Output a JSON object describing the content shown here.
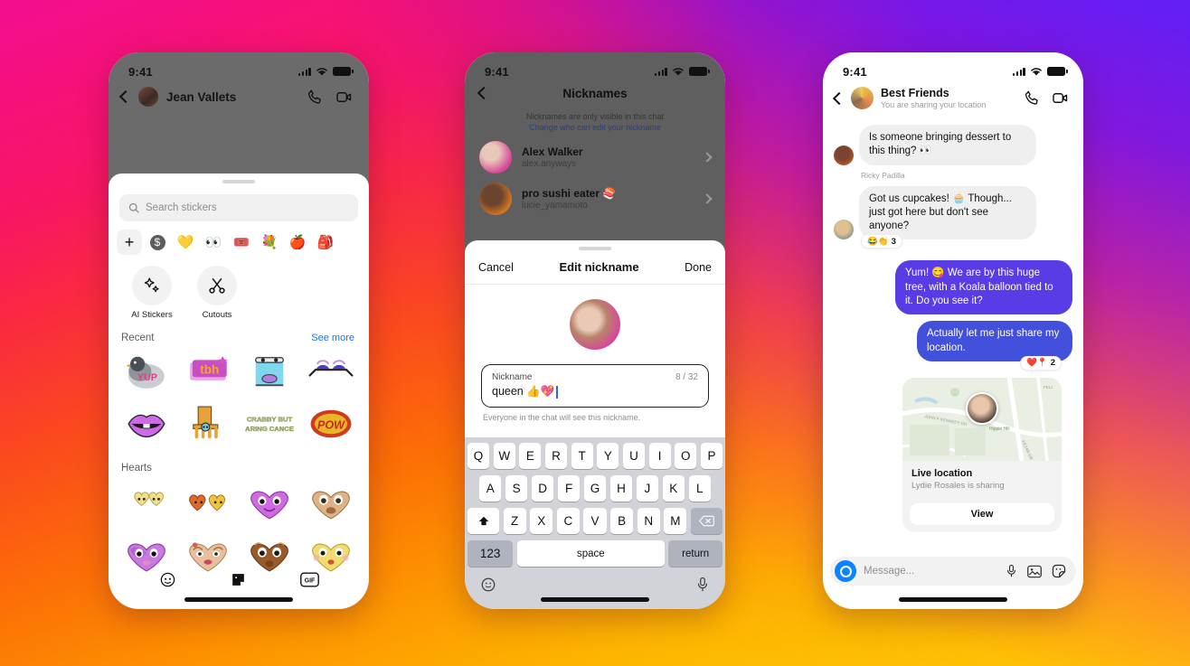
{
  "background": {
    "gradient_colors": [
      "#f20f8f",
      "#fb4a1d",
      "#ffcf00",
      "#5a1eff",
      "#a80ad0",
      "#ff1a5e"
    ]
  },
  "phone1": {
    "name": "sticker-tray-screen",
    "status": {
      "time": "9:41",
      "signal": "cellular-bars-icon",
      "wifi": "wifi-icon",
      "battery": "battery-full-icon"
    },
    "header": {
      "back": "chevron-left-icon",
      "title": "Jean Vallets",
      "call": "phone-call-icon",
      "video": "video-camera-icon"
    },
    "search": {
      "placeholder": "Search stickers",
      "icon": "search-icon"
    },
    "packs": [
      {
        "name": "add-pack",
        "glyph": "+"
      },
      {
        "name": "recent-pack",
        "glyph": "●"
      },
      {
        "name": "pack-yellow-heart",
        "glyph": "💛"
      },
      {
        "name": "pack-eyes",
        "glyph": "👀"
      },
      {
        "name": "pack-pink-card",
        "glyph": "🎟️"
      },
      {
        "name": "pack-flower",
        "glyph": "💐"
      },
      {
        "name": "pack-apple",
        "glyph": "🍎"
      },
      {
        "name": "pack-backpack",
        "glyph": "🎒"
      }
    ],
    "tools": [
      {
        "label": "AI Stickers",
        "icon": "sparkle-icon"
      },
      {
        "label": "Cutouts",
        "icon": "scissors-icon"
      }
    ],
    "sections": [
      {
        "title": "Recent",
        "action": "See more",
        "stickers": [
          {
            "name": "sticker-pigeon-yup",
            "glyph": "🐦"
          },
          {
            "name": "sticker-tbh",
            "glyph": "🔤"
          },
          {
            "name": "sticker-waterfall",
            "glyph": "🏞️"
          },
          {
            "name": "sticker-sunglasses-eyes",
            "glyph": "🕶️"
          },
          {
            "name": "sticker-purple-lips",
            "glyph": "👄"
          },
          {
            "name": "sticker-table-legs",
            "glyph": "🪑"
          },
          {
            "name": "sticker-crabby-but-caring",
            "glyph": "🦀"
          },
          {
            "name": "sticker-pow",
            "glyph": "💥"
          }
        ]
      },
      {
        "title": "Hearts",
        "action": "",
        "stickers": [
          {
            "name": "sticker-two-yellow-hearts",
            "glyph": "💛"
          },
          {
            "name": "sticker-orange-hearts",
            "glyph": "🧡"
          },
          {
            "name": "sticker-purple-heart-face",
            "glyph": "💜"
          },
          {
            "name": "sticker-tan-heart-face",
            "glyph": "🤎"
          },
          {
            "name": "sticker-violet-heart-face",
            "glyph": "💜"
          },
          {
            "name": "sticker-peach-heart-face",
            "glyph": "💖"
          },
          {
            "name": "sticker-brown-heart-face",
            "glyph": "👜"
          },
          {
            "name": "sticker-yellow-heart-kiss",
            "glyph": "💛"
          }
        ]
      }
    ],
    "tabs": [
      {
        "name": "tab-avatar",
        "glyph": "👤"
      },
      {
        "name": "tab-stickers",
        "glyph": "🏷️"
      },
      {
        "name": "tab-gif",
        "glyph": "GIF"
      }
    ]
  },
  "phone2": {
    "name": "edit-nickname-screen",
    "status": {
      "time": "9:41"
    },
    "header": {
      "back": "chevron-left-icon",
      "title": "Nicknames"
    },
    "subtitle_line1": "Nicknames are only visible in this chat",
    "subtitle_line2": "Change who can edit your nickname",
    "people": [
      {
        "name": "Alex Walker",
        "handle": "alex.anyways"
      },
      {
        "name": "pro sushi eater 🍣",
        "handle": "lucie_yamamoto"
      }
    ],
    "sheet": {
      "cancel": "Cancel",
      "title": "Edit nickname",
      "done": "Done",
      "field_label": "Nickname",
      "field_value": "queen 👍💖",
      "counter": "8 / 32",
      "help": "Everyone in the chat will see this nickname."
    },
    "keyboard": {
      "row1": [
        "Q",
        "W",
        "E",
        "R",
        "T",
        "Y",
        "U",
        "I",
        "O",
        "P"
      ],
      "row2": [
        "A",
        "S",
        "D",
        "F",
        "G",
        "H",
        "J",
        "K",
        "L"
      ],
      "row3": [
        "Z",
        "X",
        "C",
        "V",
        "B",
        "N",
        "M"
      ],
      "shift": "shift-icon",
      "backspace": "backspace-icon",
      "numbers": "123",
      "space": "space",
      "return": "return",
      "emoji": "emoji-icon",
      "mic": "microphone-icon"
    }
  },
  "phone3": {
    "name": "group-chat-screen",
    "status": {
      "time": "9:41"
    },
    "header": {
      "back": "chevron-left-icon",
      "title": "Best Friends",
      "subtitle": "You are sharing your location",
      "call": "phone-call-icon",
      "video": "video-camera-icon"
    },
    "messages": [
      {
        "side": "in",
        "sender": "",
        "text": "Is someone bringing dessert to this thing? 👀",
        "reactions": null
      },
      {
        "side": "in",
        "sender": "Ricky Padilla",
        "text": "Got us cupcakes! 🧁 Though... just got here but don't see anyone?",
        "reactions": {
          "emoji": "😂👏",
          "count": "3"
        }
      },
      {
        "side": "out1",
        "sender": "",
        "text": "Yum! 😋 We are by this huge tree, with a Koala balloon tied to it. Do you see it?",
        "reactions": null
      },
      {
        "side": "out2",
        "sender": "",
        "text": "Actually let me just share my location.",
        "reactions": {
          "emoji": "❤️📍",
          "count": "2"
        }
      }
    ],
    "location_card": {
      "title": "Live location",
      "subtitle": "Lydie Rosales is sharing",
      "button": "View",
      "map_labels": [
        "JOHN F KENNEDY DR",
        "Hippie Hill",
        "KEZAR DR",
        "FELL"
      ]
    },
    "composer": {
      "camera": "camera-icon",
      "placeholder": "Message...",
      "mic": "microphone-icon",
      "gallery": "photo-icon",
      "sticker": "sticker-icon"
    }
  }
}
